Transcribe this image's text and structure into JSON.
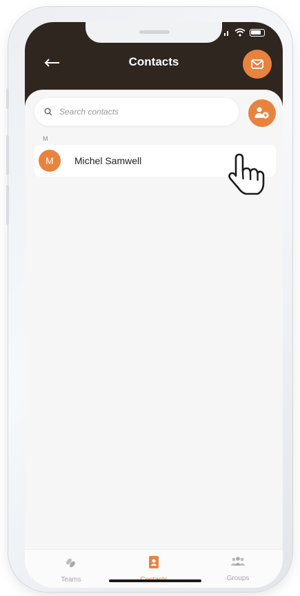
{
  "header": {
    "title": "Contacts"
  },
  "search": {
    "placeholder": "Search contacts"
  },
  "contacts": {
    "section_letter": "M",
    "items": [
      {
        "initial": "M",
        "name": "Michel Samwell"
      }
    ]
  },
  "tabs": [
    {
      "label": "Teams",
      "icon": "teams-icon",
      "active": false
    },
    {
      "label": "Contacts",
      "icon": "contacts-icon",
      "active": true
    },
    {
      "label": "Groups",
      "icon": "groups-icon",
      "active": false
    }
  ],
  "colors": {
    "accent": "#e8833f",
    "header": "#2f2620",
    "background": "#f6f6f6"
  }
}
